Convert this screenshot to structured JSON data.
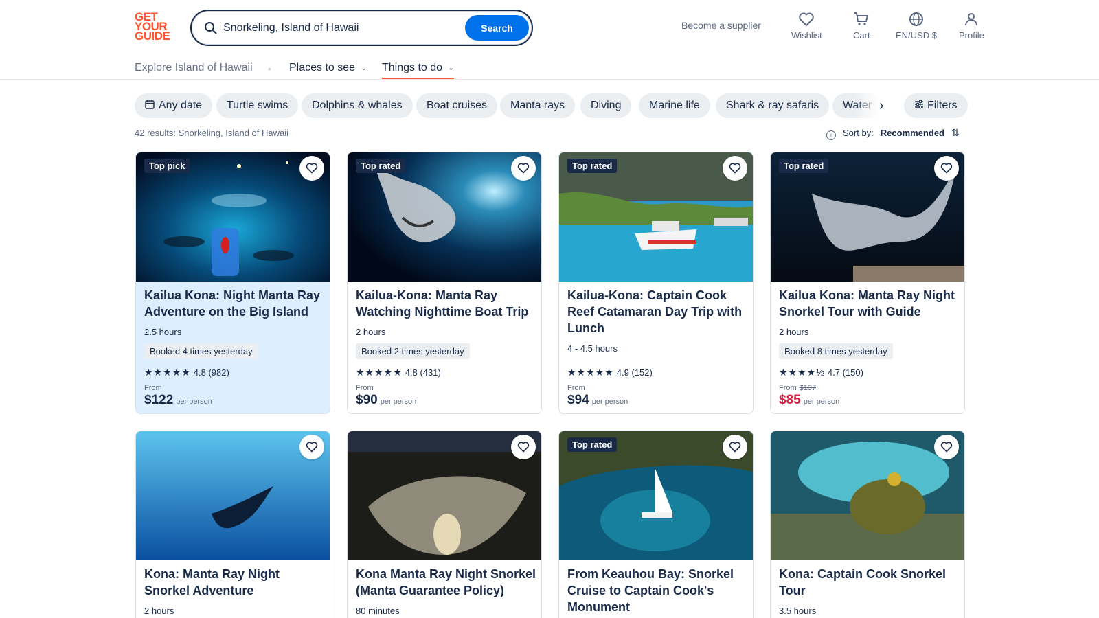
{
  "header": {
    "logo_lines": [
      "GET",
      "YOUR",
      "GUIDE"
    ],
    "search_value": "Snorkeling, Island of Hawaii",
    "search_button": "Search",
    "become_supplier": "Become a supplier",
    "wishlist": "Wishlist",
    "cart": "Cart",
    "locale": "EN/USD $",
    "profile": "Profile"
  },
  "subnav": {
    "explore": "Explore Island of Hawaii",
    "places": "Places to see",
    "things": "Things to do"
  },
  "chips": [
    "Any date",
    "Turtle swims",
    "Dolphins & whales",
    "Boat cruises",
    "Manta rays",
    "Diving",
    "Marine life",
    "Shark & ray safaris",
    "Water",
    "Filters"
  ],
  "results": {
    "count_text": "42 results:",
    "query": "Snorkeling, Island of Hawaii",
    "sort_label": "Sort by:",
    "sort_value": "Recommended"
  },
  "cards": [
    {
      "badge": "Top pick",
      "title": "Kailua Kona: Night Manta Ray Adventure on the Big Island",
      "duration": "2.5 hours",
      "booked": "Booked 4 times yesterday",
      "stars": "★★★★★",
      "rating": "4.8",
      "reviews": "(982)",
      "from": "From",
      "old_price": "",
      "price": "$122",
      "per": "per person"
    },
    {
      "badge": "Top rated",
      "title": "Kailua-Kona: Manta Ray Watching Nighttime Boat Trip",
      "duration": "2 hours",
      "booked": "Booked 2 times yesterday",
      "stars": "★★★★★",
      "rating": "4.8",
      "reviews": "(431)",
      "from": "From",
      "old_price": "",
      "price": "$90",
      "per": "per person"
    },
    {
      "badge": "Top rated",
      "title": "Kailua-Kona: Captain Cook Reef Catamaran Day Trip with Lunch",
      "duration": "4 - 4.5 hours",
      "booked": "",
      "stars": "★★★★★",
      "rating": "4.9",
      "reviews": "(152)",
      "from": "From",
      "old_price": "",
      "price": "$94",
      "per": "per person"
    },
    {
      "badge": "Top rated",
      "title": "Kailua Kona: Manta Ray Night Snorkel Tour with Guide",
      "duration": "2 hours",
      "booked": "Booked 8 times yesterday",
      "stars": "★★★★½",
      "rating": "4.7",
      "reviews": "(150)",
      "from": "From",
      "old_price": "$137",
      "price": "$85",
      "per": "per person"
    },
    {
      "badge": "",
      "title": "Kona: Manta Ray Night Snorkel Adventure",
      "duration": "2 hours"
    },
    {
      "badge": "",
      "title": "Kona Manta Ray Night Snorkel (Manta Guarantee Policy)",
      "duration": "80 minutes"
    },
    {
      "badge": "Top rated",
      "title": "From Keauhou Bay: Snorkel Cruise to Captain Cook's Monument",
      "duration": ""
    },
    {
      "badge": "",
      "title": "Kona: Captain Cook Snorkel Tour",
      "duration": "3.5 hours"
    }
  ],
  "colors": {
    "accent": "#ff5533",
    "primary": "#0071eb",
    "navy": "#1a2b49",
    "sale": "#d41f40"
  }
}
